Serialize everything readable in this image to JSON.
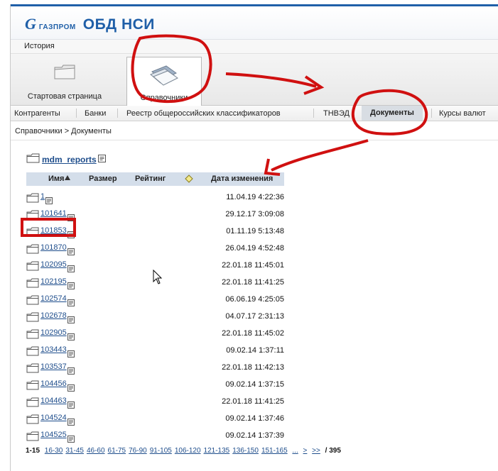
{
  "app": {
    "brand": "ГАЗПРОМ",
    "title": "ОБД НСИ"
  },
  "history": {
    "label": "История"
  },
  "ribbon": {
    "tabs": [
      {
        "label": "Стартовая страница"
      },
      {
        "label": "Справочники"
      }
    ]
  },
  "subtabs": [
    "Контрагенты",
    "Банки",
    "Реестр общероссийских классификаторов",
    "ТНВЭД",
    "Документы",
    "Курсы валют"
  ],
  "breadcrumb": "Справочники > Документы",
  "folder": {
    "name": "mdm_reports"
  },
  "table": {
    "headers": {
      "name": "Имя",
      "size": "Размер",
      "rating": "Рейтинг",
      "modified": "Дата изменения"
    },
    "rows": [
      {
        "name": "1",
        "modified": "11.04.19 4:22:36"
      },
      {
        "name": "101641",
        "modified": "29.12.17 3:09:08"
      },
      {
        "name": "101853",
        "modified": "01.11.19 5:13:48"
      },
      {
        "name": "101870",
        "modified": "26.04.19 4:52:48"
      },
      {
        "name": "102095",
        "modified": "22.01.18 11:45:01"
      },
      {
        "name": "102195",
        "modified": "22.01.18 11:41:25"
      },
      {
        "name": "102574",
        "modified": "06.06.19 4:25:05"
      },
      {
        "name": "102678",
        "modified": "04.07.17 2:31:13"
      },
      {
        "name": "102905",
        "modified": "22.01.18 11:45:02"
      },
      {
        "name": "103443",
        "modified": "09.02.14 1:37:11"
      },
      {
        "name": "103537",
        "modified": "22.01.18 11:42:13"
      },
      {
        "name": "104456",
        "modified": "09.02.14 1:37:15"
      },
      {
        "name": "104463",
        "modified": "22.01.18 11:41:25"
      },
      {
        "name": "104524",
        "modified": "09.02.14 1:37:46"
      },
      {
        "name": "104525",
        "modified": "09.02.14 1:37:39"
      }
    ]
  },
  "pager": {
    "current": "1-15",
    "pages": [
      "16-30",
      "31-45",
      "46-60",
      "61-75",
      "76-90",
      "91-105",
      "106-120",
      "121-135",
      "136-150",
      "151-165"
    ],
    "ellipsis": "...",
    "next": ">",
    "last": ">>",
    "total": "/ 395"
  },
  "colors": {
    "brand": "#1f5fa8",
    "link": "#1f4e8c",
    "annotation": "#d01010",
    "header_bg": "#d4deea"
  }
}
